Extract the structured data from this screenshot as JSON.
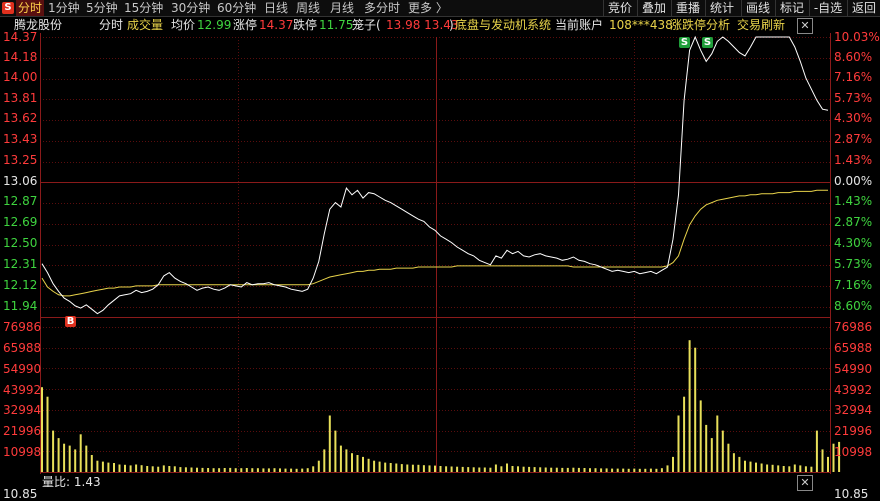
{
  "app": {
    "logo_letter": "S"
  },
  "periods": [
    "分时",
    "1分钟",
    "5分钟",
    "15分钟",
    "30分钟",
    "60分钟",
    "日线",
    "周线",
    "月线",
    "多分时",
    "更多 〉"
  ],
  "toolbar": {
    "items": [
      "竞价",
      "叠加",
      "重播",
      "统计",
      "画线",
      "标记",
      "-自选",
      "返回"
    ]
  },
  "info": {
    "stock_name": "腾龙股份",
    "mode": "分时",
    "volume_label": "成交量",
    "avg_label": "均价",
    "avg_value": "12.99",
    "limit_up_label": "涨停",
    "limit_up_value": "14.37",
    "limit_down_label": "跌停",
    "limit_down_value": "11.75",
    "cage_label": "笼子(",
    "cage_value": "13.98 13.43",
    "cage_close": ")",
    "strategy": "底盘与发动机系统",
    "account_label": "当前账户",
    "account_value": "108***438",
    "analysis_label": "涨跌停分析",
    "refresh_label": "交易刷新"
  },
  "price_axis_left": [
    "14.37",
    "14.18",
    "14.00",
    "13.81",
    "13.62",
    "13.43",
    "13.25",
    "13.06",
    "12.87",
    "12.69",
    "12.50",
    "12.31",
    "12.12",
    "11.94"
  ],
  "price_axis_right": [
    "10.03%",
    "8.60%",
    "7.16%",
    "5.73%",
    "4.30%",
    "2.87%",
    "1.43%",
    "0.00%",
    "1.43%",
    "2.87%",
    "4.30%",
    "5.73%",
    "7.16%",
    "8.60%"
  ],
  "volume_axis": [
    "76986",
    "65988",
    "54990",
    "43992",
    "32994",
    "21996",
    "10998"
  ],
  "volume_ratio": {
    "label": "量比:",
    "value": "1.43"
  },
  "bottom_value": "10.85",
  "markers": {
    "buy": "B",
    "sell": "S"
  },
  "colors": {
    "up": "#ff3b3b",
    "down": "#3fd43f",
    "price_line": "#ffffff",
    "avg_line": "#e8d34a",
    "volume": "#e8e05a",
    "grid": "#5a0d0d"
  },
  "chart_data": {
    "type": "line",
    "y_range_price": [
      11.94,
      14.37
    ],
    "prev_close": 13.06,
    "volume_range": [
      0,
      76986
    ],
    "price_series": [
      12.33,
      12.25,
      12.15,
      12.08,
      12.02,
      11.99,
      11.95,
      11.93,
      11.96,
      11.92,
      11.88,
      11.91,
      11.96,
      12.0,
      12.04,
      12.05,
      12.06,
      12.09,
      12.07,
      12.08,
      12.1,
      12.14,
      12.22,
      12.25,
      12.2,
      12.17,
      12.15,
      12.12,
      12.09,
      12.11,
      12.12,
      12.1,
      12.09,
      12.11,
      12.14,
      12.13,
      12.12,
      12.16,
      12.14,
      12.15,
      12.15,
      12.16,
      12.14,
      12.13,
      12.12,
      12.1,
      12.09,
      12.08,
      12.1,
      12.2,
      12.35,
      12.6,
      12.82,
      12.88,
      12.84,
      13.01,
      12.95,
      12.99,
      12.92,
      12.97,
      12.96,
      12.93,
      12.9,
      12.88,
      12.85,
      12.82,
      12.79,
      12.76,
      12.73,
      12.71,
      12.66,
      12.63,
      12.58,
      12.55,
      12.52,
      12.48,
      12.45,
      12.42,
      12.4,
      12.36,
      12.34,
      12.32,
      12.4,
      12.38,
      12.45,
      12.42,
      12.44,
      12.4,
      12.39,
      12.41,
      12.42,
      12.4,
      12.39,
      12.38,
      12.36,
      12.37,
      12.39,
      12.36,
      12.35,
      12.33,
      12.32,
      12.3,
      12.28,
      12.26,
      12.27,
      12.26,
      12.25,
      12.26,
      12.24,
      12.25,
      12.26,
      12.24,
      12.27,
      12.3,
      12.55,
      12.95,
      13.8,
      14.25,
      14.37,
      14.25,
      14.15,
      14.22,
      14.33,
      14.37,
      14.33,
      14.28,
      14.23,
      14.2,
      14.28,
      14.37,
      14.37,
      14.37,
      14.37,
      14.37,
      14.37,
      14.37,
      14.28,
      14.15,
      14.0,
      13.9,
      13.8,
      13.72,
      13.71
    ],
    "avg_series": [
      12.2,
      12.12,
      12.08,
      12.05,
      12.04,
      12.04,
      12.05,
      12.06,
      12.07,
      12.08,
      12.09,
      12.1,
      12.11,
      12.11,
      12.12,
      12.12,
      12.12,
      12.13,
      12.13,
      12.13,
      12.13,
      12.14,
      12.14,
      12.14,
      12.14,
      12.14,
      12.14,
      12.14,
      12.14,
      12.14,
      12.14,
      12.14,
      12.14,
      12.14,
      12.14,
      12.14,
      12.14,
      12.14,
      12.14,
      12.14,
      12.14,
      12.14,
      12.14,
      12.14,
      12.14,
      12.14,
      12.14,
      12.14,
      12.14,
      12.15,
      12.17,
      12.19,
      12.21,
      12.22,
      12.23,
      12.24,
      12.25,
      12.26,
      12.26,
      12.27,
      12.27,
      12.28,
      12.28,
      12.28,
      12.29,
      12.29,
      12.29,
      12.29,
      12.3,
      12.3,
      12.3,
      12.3,
      12.3,
      12.3,
      12.3,
      12.31,
      12.31,
      12.31,
      12.31,
      12.31,
      12.31,
      12.31,
      12.31,
      12.31,
      12.31,
      12.31,
      12.31,
      12.31,
      12.31,
      12.31,
      12.31,
      12.31,
      12.31,
      12.31,
      12.31,
      12.31,
      12.3,
      12.3,
      12.3,
      12.3,
      12.3,
      12.3,
      12.3,
      12.3,
      12.3,
      12.3,
      12.3,
      12.3,
      12.3,
      12.3,
      12.3,
      12.3,
      12.3,
      12.31,
      12.34,
      12.4,
      12.55,
      12.68,
      12.76,
      12.82,
      12.86,
      12.88,
      12.9,
      12.91,
      12.92,
      12.93,
      12.94,
      12.94,
      12.95,
      12.95,
      12.96,
      12.96,
      12.96,
      12.97,
      12.97,
      12.97,
      12.98,
      12.98,
      12.98,
      12.98,
      12.99,
      12.99,
      12.99
    ],
    "volume_series": [
      45000,
      40000,
      22000,
      18000,
      15000,
      14000,
      12000,
      20000,
      14000,
      9000,
      6000,
      5500,
      5000,
      4800,
      4000,
      3800,
      3500,
      4000,
      3600,
      3200,
      3000,
      2800,
      3500,
      3200,
      3000,
      2600,
      2500,
      2400,
      2300,
      2200,
      2100,
      2000,
      2000,
      2100,
      2200,
      2000,
      2000,
      2100,
      2000,
      2000,
      1900,
      1900,
      2000,
      1900,
      1800,
      1800,
      1700,
      1800,
      2000,
      3000,
      6000,
      12000,
      30000,
      22000,
      14000,
      12000,
      10000,
      9000,
      8000,
      7000,
      6000,
      5500,
      5000,
      4800,
      4500,
      4200,
      4000,
      3900,
      3800,
      3600,
      3500,
      3400,
      3200,
      3000,
      2900,
      2800,
      2700,
      2600,
      2500,
      2400,
      2400,
      2300,
      4000,
      3000,
      4500,
      3200,
      3000,
      2800,
      2700,
      2600,
      2500,
      2400,
      2300,
      2300,
      2200,
      2200,
      2300,
      2200,
      2100,
      2000,
      2000,
      1900,
      1900,
      1800,
      1800,
      1800,
      1700,
      1800,
      1700,
      1700,
      1800,
      1700,
      2000,
      3500,
      8000,
      30000,
      40000,
      70000,
      66000,
      38000,
      25000,
      18000,
      30000,
      22000,
      15000,
      10000,
      8000,
      6000,
      5500,
      5000,
      4500,
      4000,
      3800,
      3500,
      3200,
      3000,
      4000,
      3500,
      3000,
      2800,
      22000,
      12000,
      8000,
      15000,
      16000
    ]
  }
}
